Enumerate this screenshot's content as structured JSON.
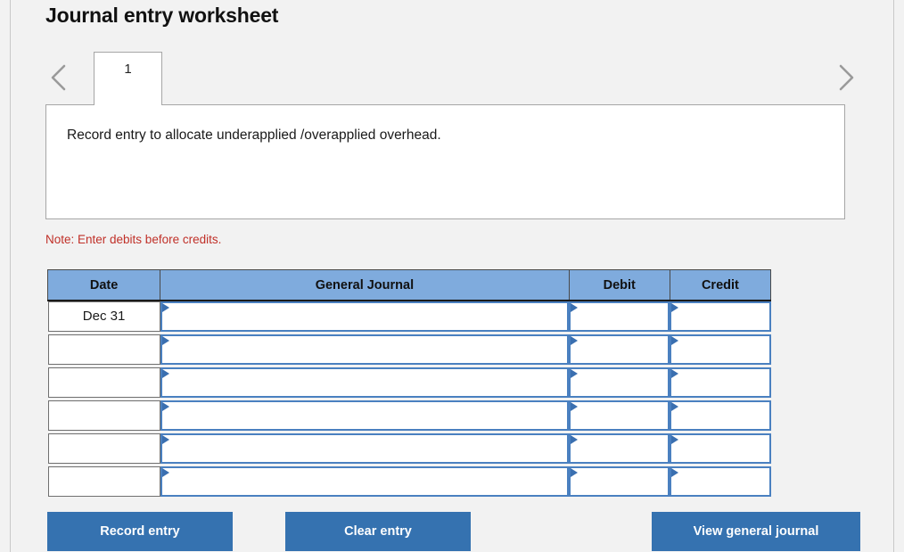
{
  "page": {
    "title": "Journal entry worksheet"
  },
  "navigation": {
    "prev_icon": "chevron-left-icon",
    "next_icon": "chevron-right-icon",
    "tabs": [
      {
        "label": "1",
        "active": true
      }
    ]
  },
  "description": {
    "text": "Record entry to allocate underapplied /overapplied overhead."
  },
  "note": {
    "text": "Note: Enter debits before credits."
  },
  "table": {
    "headers": {
      "date": "Date",
      "general_journal": "General Journal",
      "debit": "Debit",
      "credit": "Credit"
    },
    "rows": [
      {
        "date": "Dec 31",
        "general_journal": "",
        "debit": "",
        "credit": ""
      },
      {
        "date": "",
        "general_journal": "",
        "debit": "",
        "credit": ""
      },
      {
        "date": "",
        "general_journal": "",
        "debit": "",
        "credit": ""
      },
      {
        "date": "",
        "general_journal": "",
        "debit": "",
        "credit": ""
      },
      {
        "date": "",
        "general_journal": "",
        "debit": "",
        "credit": ""
      },
      {
        "date": "",
        "general_journal": "",
        "debit": "",
        "credit": ""
      }
    ]
  },
  "buttons": {
    "record": "Record entry",
    "clear": "Clear entry",
    "view": "View general journal"
  },
  "colors": {
    "header_blue": "#7fabdd",
    "button_blue": "#3572b0",
    "cell_border_blue": "#4a80c0",
    "note_red": "#c03028",
    "page_background": "#f2f2f2"
  }
}
